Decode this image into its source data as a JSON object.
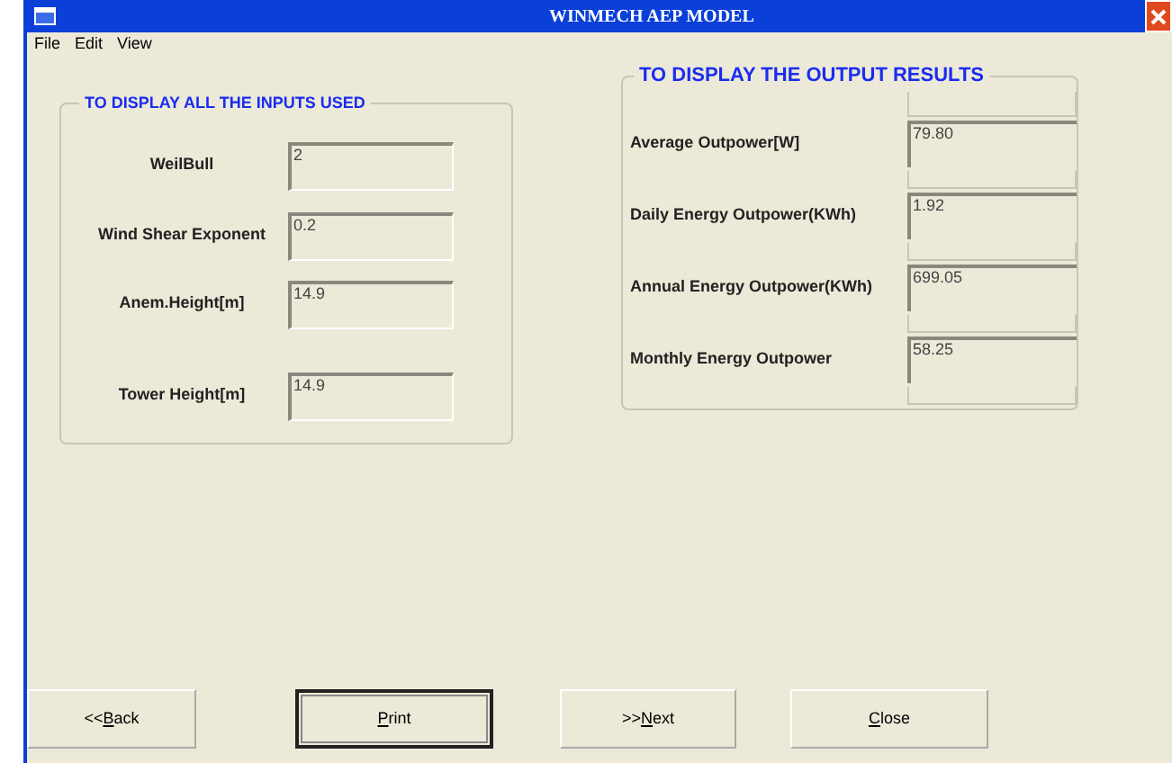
{
  "window": {
    "title": "WINMECH AEP MODEL"
  },
  "menu": [
    "File",
    "Edit",
    "View"
  ],
  "inputs": {
    "title": "TO DISPLAY ALL THE INPUTS USED",
    "fields": [
      {
        "label": "WeilBull",
        "value": "2"
      },
      {
        "label": "Wind Shear Exponent",
        "value": "0.2"
      },
      {
        "label": "Anem.Height[m]",
        "value": "14.9"
      },
      {
        "label": "Tower Height[m]",
        "value": "14.9"
      }
    ]
  },
  "outputs": {
    "title": "TO DISPLAY THE OUTPUT RESULTS",
    "fields": [
      {
        "label": "Average Outpower[W]",
        "value": "79.80"
      },
      {
        "label": "Daily Energy Outpower(KWh)",
        "value": "1.92"
      },
      {
        "label": "Annual Energy Outpower(KWh)",
        "value": "699.05"
      },
      {
        "label": "Monthly Energy Outpower",
        "value": "58.25"
      }
    ]
  },
  "buttons": [
    {
      "before": "<<",
      "key": "B",
      "after": "ack",
      "selected": false
    },
    {
      "key": "P",
      "after": "rint",
      "selected": true
    },
    {
      "before": ">>",
      "key": "N",
      "after": "ext",
      "selected": false
    },
    {
      "key": "C",
      "after": "lose",
      "selected": false
    }
  ]
}
